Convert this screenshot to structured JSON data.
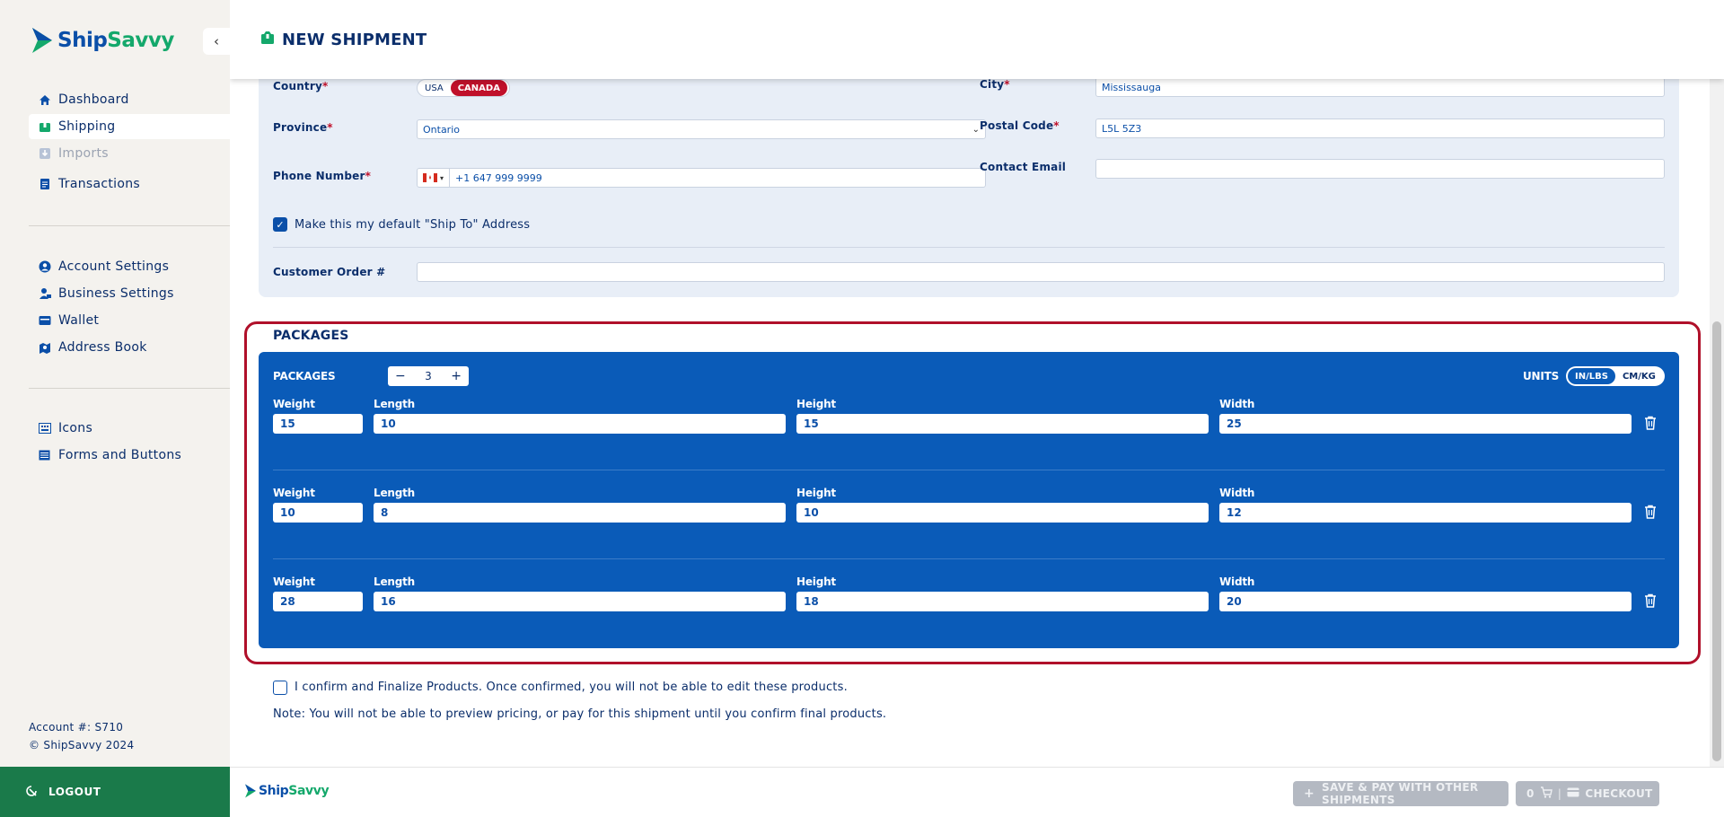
{
  "brand": {
    "name_part1": "Ship",
    "name_part2": "Savvy",
    "primary": "#0b4fa8",
    "accent": "#14a86b",
    "alert": "#c0102a"
  },
  "sidebar": {
    "items_main": [
      {
        "label": "Dashboard",
        "icon": "home-icon"
      },
      {
        "label": "Shipping",
        "icon": "package-icon",
        "active": true
      },
      {
        "label": "Imports",
        "icon": "import-icon",
        "disabled": true
      },
      {
        "label": "Transactions",
        "icon": "document-icon"
      }
    ],
    "items_settings": [
      {
        "label": "Account Settings",
        "icon": "user-circle-icon"
      },
      {
        "label": "Business Settings",
        "icon": "business-user-icon"
      },
      {
        "label": "Wallet",
        "icon": "wallet-icon"
      },
      {
        "label": "Address Book",
        "icon": "address-book-icon"
      }
    ],
    "items_dev": [
      {
        "label": "Icons",
        "icon": "icons-icon"
      },
      {
        "label": "Forms and Buttons",
        "icon": "list-icon"
      }
    ],
    "account_line": "Account #: S710",
    "copyright": "© ShipSavvy 2024",
    "logout": "LOGOUT"
  },
  "header": {
    "title": "NEW SHIPMENT"
  },
  "address": {
    "country_label": "Country",
    "country_options": [
      "USA",
      "CANADA"
    ],
    "country_selected": "CANADA",
    "city_label": "City",
    "city_value": "Mississauga",
    "province_label": "Province",
    "province_value": "Ontario",
    "postal_label": "Postal Code",
    "postal_value": "L5L 5Z3",
    "phone_label": "Phone Number",
    "phone_value": "+1 647 999 9999",
    "email_label": "Contact Email",
    "email_value": "",
    "default_checkbox_label": "Make this my default \"Ship To\" Address",
    "default_checked": true,
    "order_label": "Customer Order #",
    "order_value": ""
  },
  "packages": {
    "section_title": "PACKAGES",
    "count_label": "PACKAGES",
    "count": "3",
    "units_label": "UNITS",
    "units_options": [
      "IN/LBS",
      "CM/KG"
    ],
    "units_selected": "IN/LBS",
    "field_labels": {
      "weight": "Weight",
      "length": "Length",
      "height": "Height",
      "width": "Width"
    },
    "rows": [
      {
        "weight": "15",
        "length": "10",
        "height": "15",
        "width": "25"
      },
      {
        "weight": "10",
        "length": "8",
        "height": "10",
        "width": "12"
      },
      {
        "weight": "28",
        "length": "16",
        "height": "18",
        "width": "20"
      }
    ]
  },
  "confirm": {
    "checkbox_label": "I confirm and Finalize Products. Once confirmed, you will not be able to edit these products.",
    "note": "Note: You will not be able to preview pricing, or pay for this shipment until you confirm final products."
  },
  "footer": {
    "save_pay_label": "SAVE & PAY WITH OTHER SHIPMENTS",
    "cart_count": "0",
    "checkout_label": "CHECKOUT"
  }
}
